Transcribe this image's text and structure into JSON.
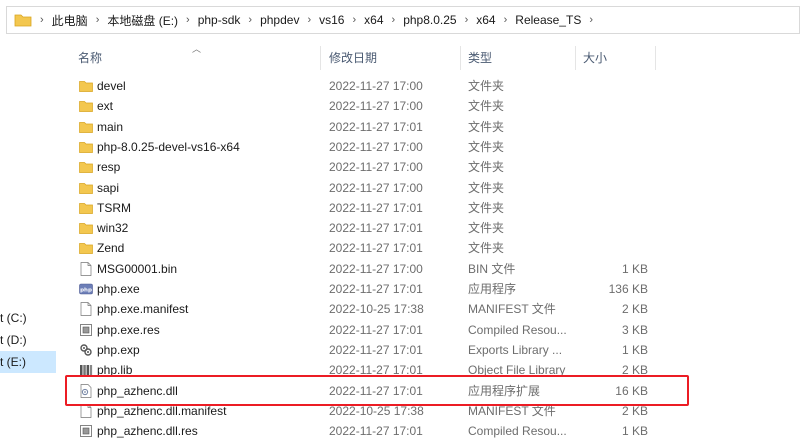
{
  "breadcrumb": {
    "items": [
      "此电脑",
      "本地磁盘 (E:)",
      "php-sdk",
      "phpdev",
      "vs16",
      "x64",
      "php8.0.25",
      "x64",
      "Release_TS"
    ]
  },
  "nav": {
    "items": [
      {
        "label": "t (C:)",
        "selected": false
      },
      {
        "label": "t (D:)",
        "selected": false
      },
      {
        "label": "t (E:)",
        "selected": true
      }
    ]
  },
  "columns": {
    "name": "名称",
    "date": "修改日期",
    "type": "类型",
    "size": "大小"
  },
  "files": [
    {
      "icon": "folder-icon",
      "name": "devel",
      "date": "2022-11-27 17:00",
      "type": "文件夹",
      "size": ""
    },
    {
      "icon": "folder-icon",
      "name": "ext",
      "date": "2022-11-27 17:00",
      "type": "文件夹",
      "size": ""
    },
    {
      "icon": "folder-icon",
      "name": "main",
      "date": "2022-11-27 17:01",
      "type": "文件夹",
      "size": ""
    },
    {
      "icon": "folder-icon",
      "name": "php-8.0.25-devel-vs16-x64",
      "date": "2022-11-27 17:00",
      "type": "文件夹",
      "size": ""
    },
    {
      "icon": "folder-icon",
      "name": "resp",
      "date": "2022-11-27 17:00",
      "type": "文件夹",
      "size": ""
    },
    {
      "icon": "folder-icon",
      "name": "sapi",
      "date": "2022-11-27 17:00",
      "type": "文件夹",
      "size": ""
    },
    {
      "icon": "folder-icon",
      "name": "TSRM",
      "date": "2022-11-27 17:01",
      "type": "文件夹",
      "size": ""
    },
    {
      "icon": "folder-icon",
      "name": "win32",
      "date": "2022-11-27 17:01",
      "type": "文件夹",
      "size": ""
    },
    {
      "icon": "folder-icon",
      "name": "Zend",
      "date": "2022-11-27 17:01",
      "type": "文件夹",
      "size": ""
    },
    {
      "icon": "file-icon",
      "name": "MSG00001.bin",
      "date": "2022-11-27 17:00",
      "type": "BIN 文件",
      "size": "1 KB"
    },
    {
      "icon": "php-exe-icon",
      "name": "php.exe",
      "date": "2022-11-27 17:01",
      "type": "应用程序",
      "size": "136 KB"
    },
    {
      "icon": "file-icon",
      "name": "php.exe.manifest",
      "date": "2022-10-25 17:38",
      "type": "MANIFEST 文件",
      "size": "2 KB"
    },
    {
      "icon": "res-icon",
      "name": "php.exe.res",
      "date": "2022-11-27 17:01",
      "type": "Compiled Resou...",
      "size": "3 KB"
    },
    {
      "icon": "exp-icon",
      "name": "php.exp",
      "date": "2022-11-27 17:01",
      "type": "Exports Library ...",
      "size": "1 KB"
    },
    {
      "icon": "lib-icon",
      "name": "php.lib",
      "date": "2022-11-27 17:01",
      "type": "Object File Library",
      "size": "2 KB"
    },
    {
      "icon": "dll-icon",
      "name": "php_azhenc.dll",
      "date": "2022-11-27 17:01",
      "type": "应用程序扩展",
      "size": "16 KB"
    },
    {
      "icon": "file-icon",
      "name": "php_azhenc.dll.manifest",
      "date": "2022-10-25 17:38",
      "type": "MANIFEST 文件",
      "size": "2 KB"
    },
    {
      "icon": "res-icon",
      "name": "php_azhenc.dll.res",
      "date": "2022-11-27 17:01",
      "type": "Compiled Resou...",
      "size": "1 KB"
    }
  ],
  "colors": {
    "highlight_border": "#ec1c24",
    "folder": "#f3c74f",
    "selected_nav": "#cce8ff"
  }
}
